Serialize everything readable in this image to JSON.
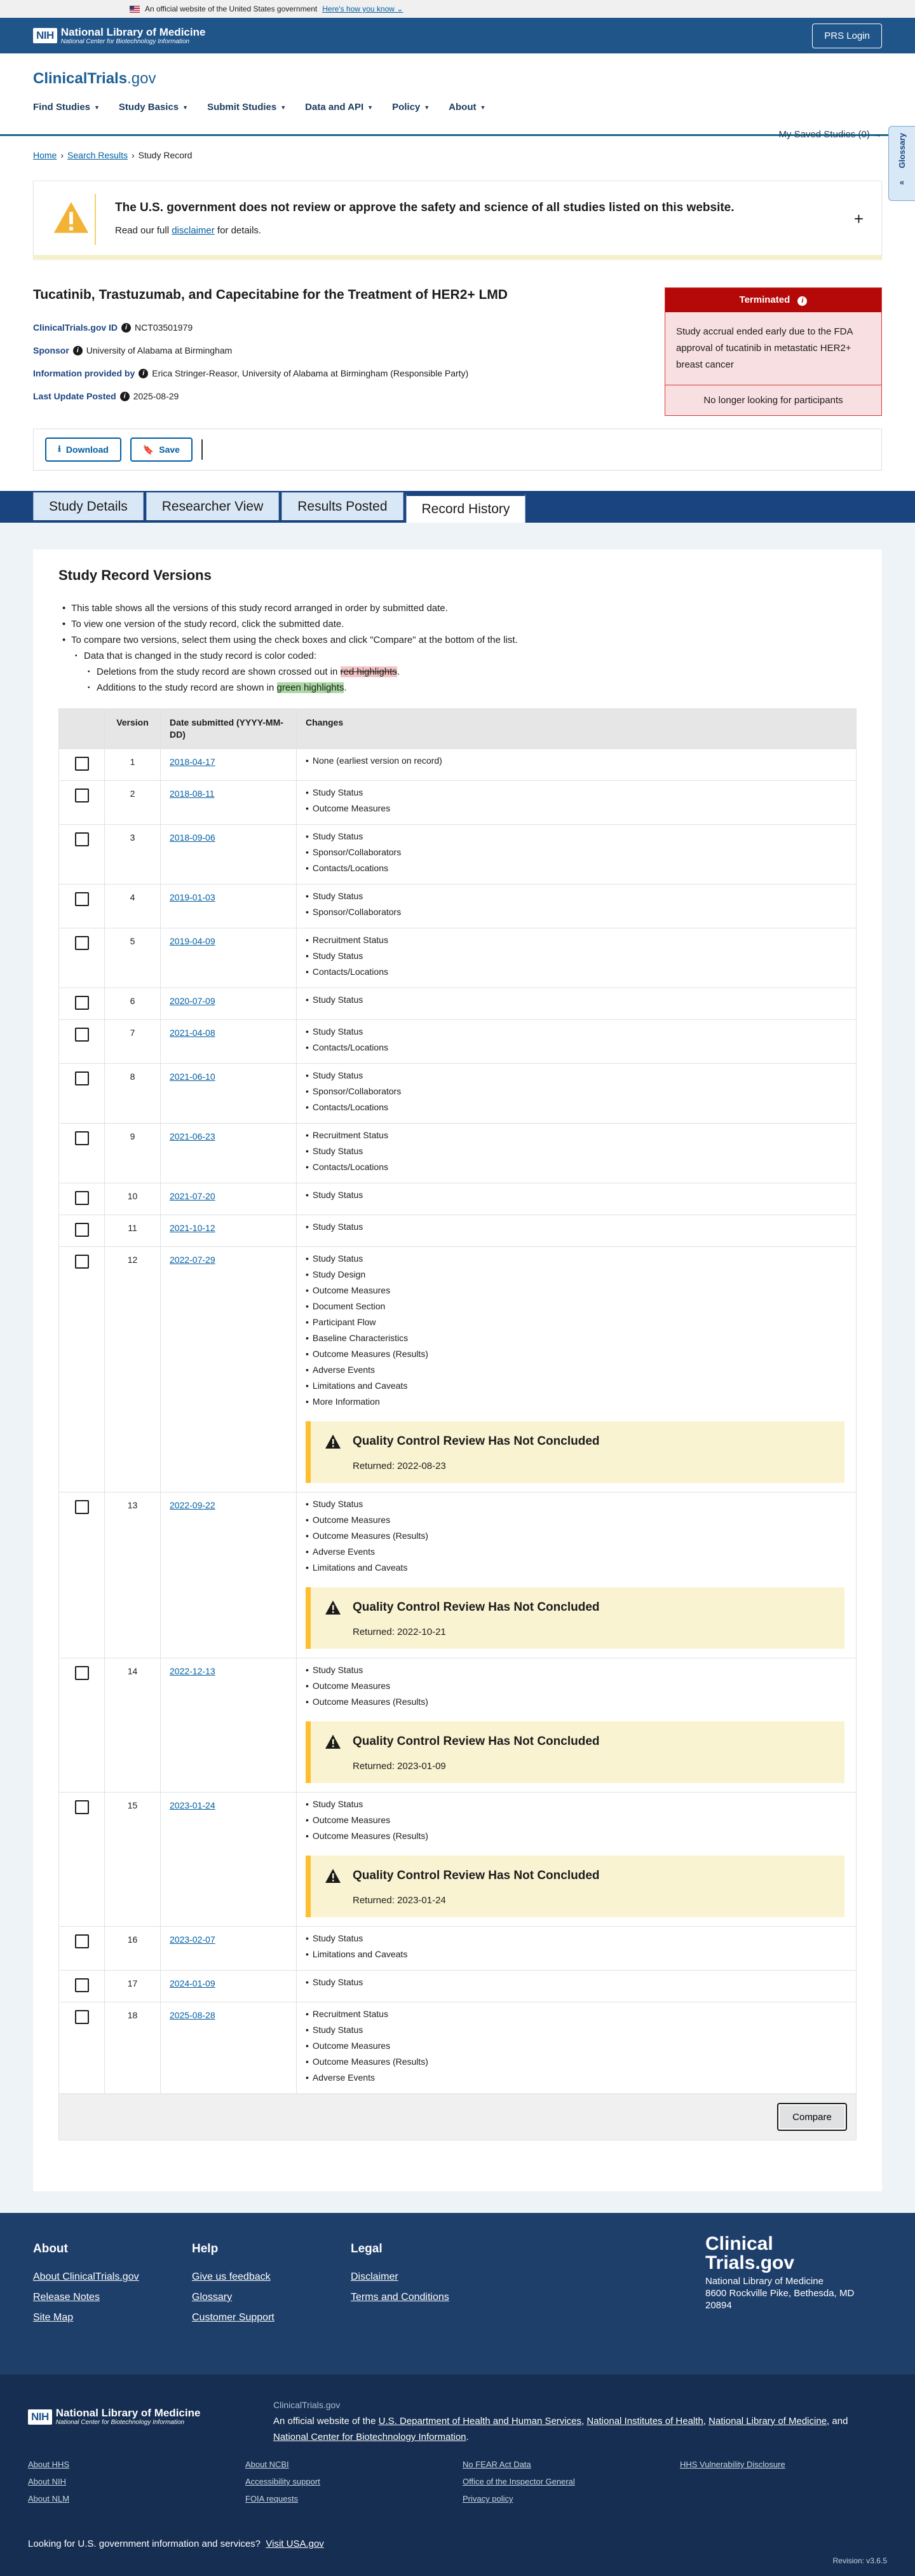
{
  "gov_banner": {
    "text": "An official website of the United States government",
    "know": "Here's how you know"
  },
  "nih": {
    "logo": "NIH",
    "title": "National Library of Medicine",
    "subtitle": "National Center for Biotechnology Information",
    "prs": "PRS Login"
  },
  "brand": {
    "name": "ClinicalTrials",
    "tld": ".gov"
  },
  "nav": [
    {
      "label": "Find Studies"
    },
    {
      "label": "Study Basics"
    },
    {
      "label": "Submit Studies"
    },
    {
      "label": "Data and API"
    },
    {
      "label": "Policy"
    },
    {
      "label": "About"
    }
  ],
  "saved": "My Saved Studies (0) →",
  "breadcrumb": {
    "home": "Home",
    "search": "Search Results",
    "current": "Study Record"
  },
  "glossary": "Glossary",
  "alert": {
    "heading": "The U.S. government does not review or approve the safety and science of all studies listed on this website.",
    "pre": "Read our full ",
    "link": "disclaimer",
    "post": " for details."
  },
  "study": {
    "title": "Tucatinib, Trastuzumab, and Capecitabine for the Treatment of HER2+ LMD",
    "id_label": "ClinicalTrials.gov ID",
    "id": "NCT03501979",
    "sponsor_label": "Sponsor",
    "sponsor": "University of Alabama at Birmingham",
    "info_label": "Information provided by",
    "info": "Erica Stringer-Reasor, University of Alabama at Birmingham (Responsible Party)",
    "update_label": "Last Update Posted",
    "update": "2025-08-29"
  },
  "status": {
    "label": "Terminated",
    "reason": "Study accrual ended early due to the FDA approval of tucatinib in metastatic HER2+ breast cancer",
    "recruiting": "No longer looking for participants"
  },
  "actions": {
    "download": "Download",
    "save": "Save"
  },
  "tabs": [
    {
      "label": "Study Details"
    },
    {
      "label": "Researcher View"
    },
    {
      "label": "Results Posted"
    },
    {
      "label": "Record History"
    }
  ],
  "versions": {
    "heading": "Study Record Versions",
    "b1": "This table shows all the versions of this study record arranged in order by submitted date.",
    "b2": "To view one version of the study record, click the submitted date.",
    "b3": "To compare two versions, select them using the check boxes and click \"Compare\" at the bottom of the list.",
    "b4": "Data that is changed in the study record is color coded:",
    "b5_pre": "Deletions from the study record are shown crossed out in ",
    "b5_hl": "red highlights",
    "b5_post": ".",
    "b6_pre": "Additions to the study record are shown in ",
    "b6_hl": "green highlights",
    "b6_post": ".",
    "col_version": "Version",
    "col_date": "Date submitted (YYYY-MM-DD)",
    "col_changes": "Changes",
    "qc_title": "Quality Control Review Has Not Concluded",
    "compare": "Compare",
    "rows": [
      {
        "v": "1",
        "date": "2018-04-17",
        "changes": [
          "None (earliest version on record)"
        ]
      },
      {
        "v": "2",
        "date": "2018-08-11",
        "changes": [
          "Study Status",
          "Outcome Measures"
        ]
      },
      {
        "v": "3",
        "date": "2018-09-06",
        "changes": [
          "Study Status",
          "Sponsor/Collaborators",
          "Contacts/Locations"
        ]
      },
      {
        "v": "4",
        "date": "2019-01-03",
        "changes": [
          "Study Status",
          "Sponsor/Collaborators"
        ]
      },
      {
        "v": "5",
        "date": "2019-04-09",
        "changes": [
          "Recruitment Status",
          "Study Status",
          "Contacts/Locations"
        ]
      },
      {
        "v": "6",
        "date": "2020-07-09",
        "changes": [
          "Study Status"
        ]
      },
      {
        "v": "7",
        "date": "2021-04-08",
        "changes": [
          "Study Status",
          "Contacts/Locations"
        ]
      },
      {
        "v": "8",
        "date": "2021-06-10",
        "changes": [
          "Study Status",
          "Sponsor/Collaborators",
          "Contacts/Locations"
        ]
      },
      {
        "v": "9",
        "date": "2021-06-23",
        "changes": [
          "Recruitment Status",
          "Study Status",
          "Contacts/Locations"
        ]
      },
      {
        "v": "10",
        "date": "2021-07-20",
        "changes": [
          "Study Status"
        ]
      },
      {
        "v": "11",
        "date": "2021-10-12",
        "changes": [
          "Study Status"
        ]
      },
      {
        "v": "12",
        "date": "2022-07-29",
        "changes": [
          "Study Status",
          "Study Design",
          "Outcome Measures",
          "Document Section",
          "Participant Flow",
          "Baseline Characteristics",
          "Outcome Measures (Results)",
          "Adverse Events",
          "Limitations and Caveats",
          "More Information"
        ],
        "qc": "Returned: 2022-08-23"
      },
      {
        "v": "13",
        "date": "2022-09-22",
        "changes": [
          "Study Status",
          "Outcome Measures",
          "Outcome Measures (Results)",
          "Adverse Events",
          "Limitations and Caveats"
        ],
        "qc": "Returned: 2022-10-21"
      },
      {
        "v": "14",
        "date": "2022-12-13",
        "changes": [
          "Study Status",
          "Outcome Measures",
          "Outcome Measures (Results)"
        ],
        "qc": "Returned: 2023-01-09"
      },
      {
        "v": "15",
        "date": "2023-01-24",
        "changes": [
          "Study Status",
          "Outcome Measures",
          "Outcome Measures (Results)"
        ],
        "qc": "Returned: 2023-01-24"
      },
      {
        "v": "16",
        "date": "2023-02-07",
        "changes": [
          "Study Status",
          "Limitations and Caveats"
        ]
      },
      {
        "v": "17",
        "date": "2024-01-09",
        "changes": [
          "Study Status"
        ]
      },
      {
        "v": "18",
        "date": "2025-08-28",
        "changes": [
          "Recruitment Status",
          "Study Status",
          "Outcome Measures",
          "Outcome Measures (Results)",
          "Adverse Events"
        ]
      }
    ]
  },
  "footer": {
    "about_h": "About",
    "about": [
      "About ClinicalTrials.gov",
      "Release Notes",
      "Site Map"
    ],
    "help_h": "Help",
    "help": [
      "Give us feedback",
      "Glossary",
      "Customer Support"
    ],
    "legal_h": "Legal",
    "legal": [
      "Disclaimer",
      "Terms and Conditions"
    ],
    "brand1": "Clinical",
    "brand2": "Trials.gov",
    "org": "National Library of Medicine",
    "addr1": "8600 Rockville Pike, Bethesda, MD",
    "addr2": "20894",
    "ct": "ClinicalTrials.gov",
    "official_pre": "An official website of the ",
    "hhs": "U.S. Department of Health and Human Services",
    "nihl": "National Institutes of Health",
    "nlm": "National Library of Medicine",
    "and": ", and ",
    "ncbi": "National Center for Biotechnology Information",
    "links": [
      "About HHS",
      "About NCBI",
      "No FEAR Act Data",
      "HHS Vulnerability Disclosure",
      "About NIH",
      "Accessibility support",
      "Office of the Inspector General",
      "",
      "About NLM",
      "FOIA requests",
      "Privacy policy",
      ""
    ],
    "usa_pre": "Looking for U.S. government information and services?",
    "usa": "Visit USA.gov",
    "revision": "Revision: v3.6.5"
  }
}
